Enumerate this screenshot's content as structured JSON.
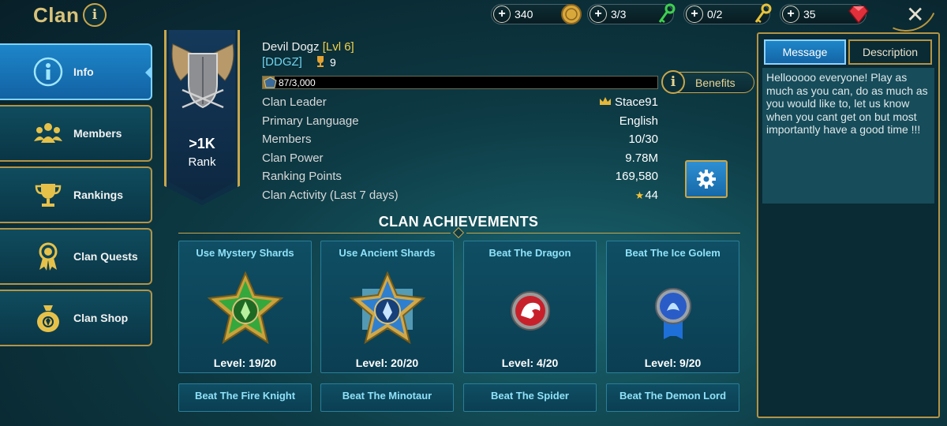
{
  "header": {
    "title": "Clan",
    "resources": [
      {
        "value": "340",
        "icon": "silver-coin-icon"
      },
      {
        "value": "3/3",
        "icon": "green-key-icon"
      },
      {
        "value": "0/2",
        "icon": "gold-key-icon"
      },
      {
        "value": "35",
        "icon": "ruby-gem-icon"
      }
    ],
    "close": "✕"
  },
  "sidebar": {
    "items": [
      {
        "label": "Info",
        "icon": "info-icon",
        "active": true
      },
      {
        "label": "Members",
        "icon": "members-icon"
      },
      {
        "label": "Rankings",
        "icon": "trophy-icon"
      },
      {
        "label": "Clan Quests",
        "icon": "medal-icon"
      },
      {
        "label": "Clan Shop",
        "icon": "money-bag-icon"
      }
    ]
  },
  "banner": {
    "rank_value": ">1K",
    "rank_label": "Rank"
  },
  "clan": {
    "name": "Devil Dogz",
    "level": "[Lvl 6]",
    "tag": "[DDGZ]",
    "trophies": "9",
    "xp_text": "87/3,000",
    "xp_progress": 0.029,
    "benefits_label": "Benefits",
    "stats": [
      {
        "label": "Clan Leader",
        "value": "Stace91"
      },
      {
        "label": "Primary Language",
        "value": "English"
      },
      {
        "label": "Members",
        "value": "10/30"
      },
      {
        "label": "Clan Power",
        "value": "9.78M"
      },
      {
        "label": "Ranking Points",
        "value": "169,580"
      },
      {
        "label": "Clan Activity (Last 7 days)",
        "value": "44"
      }
    ]
  },
  "achievements": {
    "heading": "CLAN ACHIEVEMENTS",
    "cards": [
      {
        "title": "Use Mystery Shards",
        "level": "Level: 19/20",
        "icon": "green-star-emblem-icon"
      },
      {
        "title": "Use Ancient Shards",
        "level": "Level: 20/20",
        "icon": "blue-star-emblem-icon"
      },
      {
        "title": "Beat The Dragon",
        "level": "Level: 4/20",
        "icon": "red-dragon-emblem-icon"
      },
      {
        "title": "Beat The Ice Golem",
        "level": "Level: 9/20",
        "icon": "blue-golem-emblem-icon"
      }
    ],
    "row2": [
      {
        "title": "Beat The Fire Knight"
      },
      {
        "title": "Beat The Minotaur"
      },
      {
        "title": "Beat The Spider"
      },
      {
        "title": "Beat The Demon Lord"
      }
    ]
  },
  "panel": {
    "tabs": [
      {
        "label": "Message",
        "active": true
      },
      {
        "label": "Description"
      }
    ],
    "message": "Hellooooo everyone! Play as much as you can, do as much as you would like to, let us know when you cant get on but most importantly have a good time !!!"
  },
  "colors": {
    "gold": "#c9a64b",
    "accent_blue": "#1d86c9",
    "panel_teal": "#174c5a"
  }
}
